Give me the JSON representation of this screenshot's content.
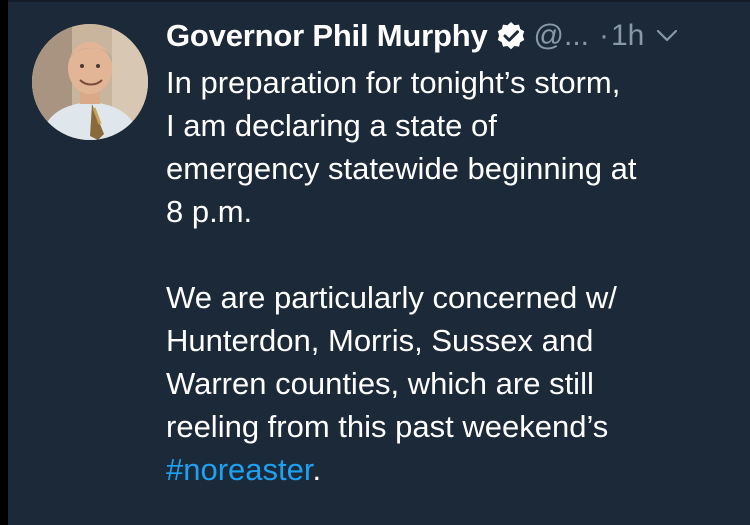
{
  "tweet": {
    "author_name": "Governor Phil Murphy",
    "handle": "@...",
    "separator": "·",
    "time": "1h",
    "paragraph1": [
      "In preparation for tonight’s storm,",
      "I am declaring a state of",
      "emergency statewide beginning at",
      "8 p.m."
    ],
    "paragraph2": [
      "We are particularly concerned w/",
      "Hunterdon, Morris, Sussex and",
      "Warren counties, which are still",
      "reeling from this past weekend’s"
    ],
    "hashtag": "#noreaster",
    "trailing_punct": "."
  },
  "icons": {
    "verified": "verified-badge-icon",
    "menu": "chevron-down-icon"
  },
  "colors": {
    "background": "#1c2938",
    "text": "#ffffff",
    "muted": "#8899a6",
    "link": "#1da1f2"
  }
}
